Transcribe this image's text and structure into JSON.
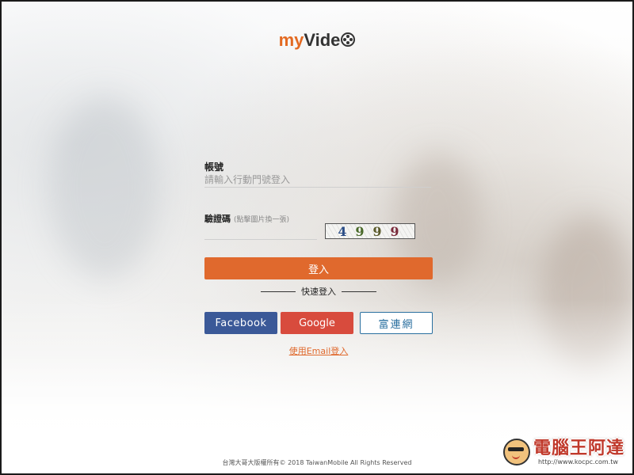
{
  "logo": {
    "part1": "my",
    "part2": "Vide"
  },
  "account": {
    "label": "帳號",
    "placeholder": "請輸入行動門號登入",
    "value": ""
  },
  "captcha": {
    "label": "驗證碼",
    "hint": "(點擊圖片換一張)",
    "digits": [
      "4",
      "9",
      "9",
      "9"
    ]
  },
  "login_button": "登入",
  "quick_login": "快速登入",
  "social": {
    "facebook": "Facebook",
    "google": "Google",
    "twm": "富連網"
  },
  "email_login": "使用Email登入",
  "footer": "台灣大哥大版權所有© 2018 TaiwanMobile All Rights Reserved",
  "watermark": {
    "title": "電腦王阿達",
    "url": "http://www.kocpc.com.tw"
  },
  "colors": {
    "accent": "#e0692d",
    "facebook": "#3b5998",
    "google": "#d84b3d",
    "twm": "#2a6f9f"
  }
}
